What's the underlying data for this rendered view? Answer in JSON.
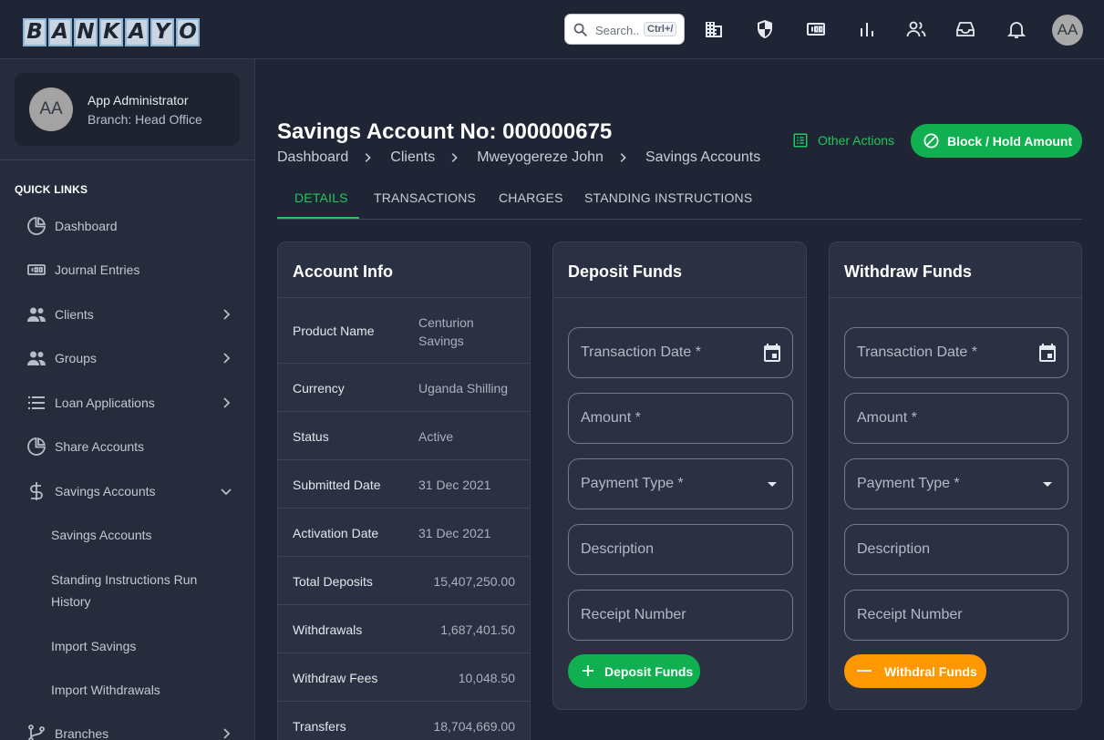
{
  "brand": {
    "letters": [
      "B",
      "A",
      "N",
      "K",
      "A",
      "Y",
      "O"
    ]
  },
  "search": {
    "placeholder": "Search..",
    "shortcut": "Ctrl+/"
  },
  "topbar": {
    "avatar_initials": "AA"
  },
  "user": {
    "initials": "AA",
    "name": "App Administrator",
    "branch": "Branch: Head Office"
  },
  "sidebar": {
    "section_title": "QUICK LINKS",
    "items": [
      {
        "label": "Dashboard",
        "icon": "pie-chart-icon"
      },
      {
        "label": "Journal Entries",
        "icon": "money-icon"
      },
      {
        "label": "Clients",
        "icon": "people-icon"
      },
      {
        "label": "Groups",
        "icon": "people-icon"
      },
      {
        "label": "Loan Applications",
        "icon": "list-icon"
      },
      {
        "label": "Share Accounts",
        "icon": "pie-chart-icon"
      },
      {
        "label": "Savings Accounts",
        "icon": "dollar-icon"
      },
      {
        "label": "Branches",
        "icon": "branch-icon"
      }
    ],
    "sub_items": [
      {
        "label": "Savings Accounts"
      },
      {
        "label": "Standing Instructions Run History"
      },
      {
        "label": "Import Savings"
      },
      {
        "label": "Import Withdrawals"
      }
    ]
  },
  "page": {
    "title": "Savings Account No: 000000675",
    "breadcrumbs": [
      "Dashboard",
      "Clients",
      "Mweyogereze John",
      "Savings Accounts"
    ],
    "other_actions_label": "Other Actions",
    "block_button_label": "Block / Hold Amount"
  },
  "tabs": [
    {
      "label": "DETAILS",
      "active": true
    },
    {
      "label": "TRANSACTIONS",
      "active": false
    },
    {
      "label": "CHARGES",
      "active": false
    },
    {
      "label": "STANDING INSTRUCTIONS",
      "active": false
    }
  ],
  "account_info": {
    "title": "Account Info",
    "rows": [
      {
        "label": "Product Name",
        "value": "Centurion Savings"
      },
      {
        "label": "Currency",
        "value": "Uganda Shilling"
      },
      {
        "label": "Status",
        "value": "Active"
      },
      {
        "label": "Submitted Date",
        "value": "31 Dec 2021"
      },
      {
        "label": "Activation Date",
        "value": "31 Dec 2021"
      },
      {
        "label": "Total Deposits",
        "value": "15,407,250.00"
      },
      {
        "label": "Withdrawals",
        "value": "1,687,401.50"
      },
      {
        "label": "Withdraw Fees",
        "value": "10,048.50"
      },
      {
        "label": "Transfers",
        "value": "18,704,669.00"
      }
    ]
  },
  "deposit": {
    "title": "Deposit Funds",
    "fields": {
      "date": "Transaction Date *",
      "amount": "Amount *",
      "payment_type": "Payment Type *",
      "description": "Description",
      "receipt": "Receipt Number"
    },
    "button_label": "Deposit Funds"
  },
  "withdraw": {
    "title": "Withdraw Funds",
    "fields": {
      "date": "Transaction Date *",
      "amount": "Amount *",
      "payment_type": "Payment Type *",
      "description": "Description",
      "receipt": "Receipt Number"
    },
    "button_label": "Withdral Funds"
  },
  "colors": {
    "accent": "#22c55e",
    "primary_button": "#10b050",
    "warning_button": "#ff9800",
    "background": "#1f2534"
  }
}
